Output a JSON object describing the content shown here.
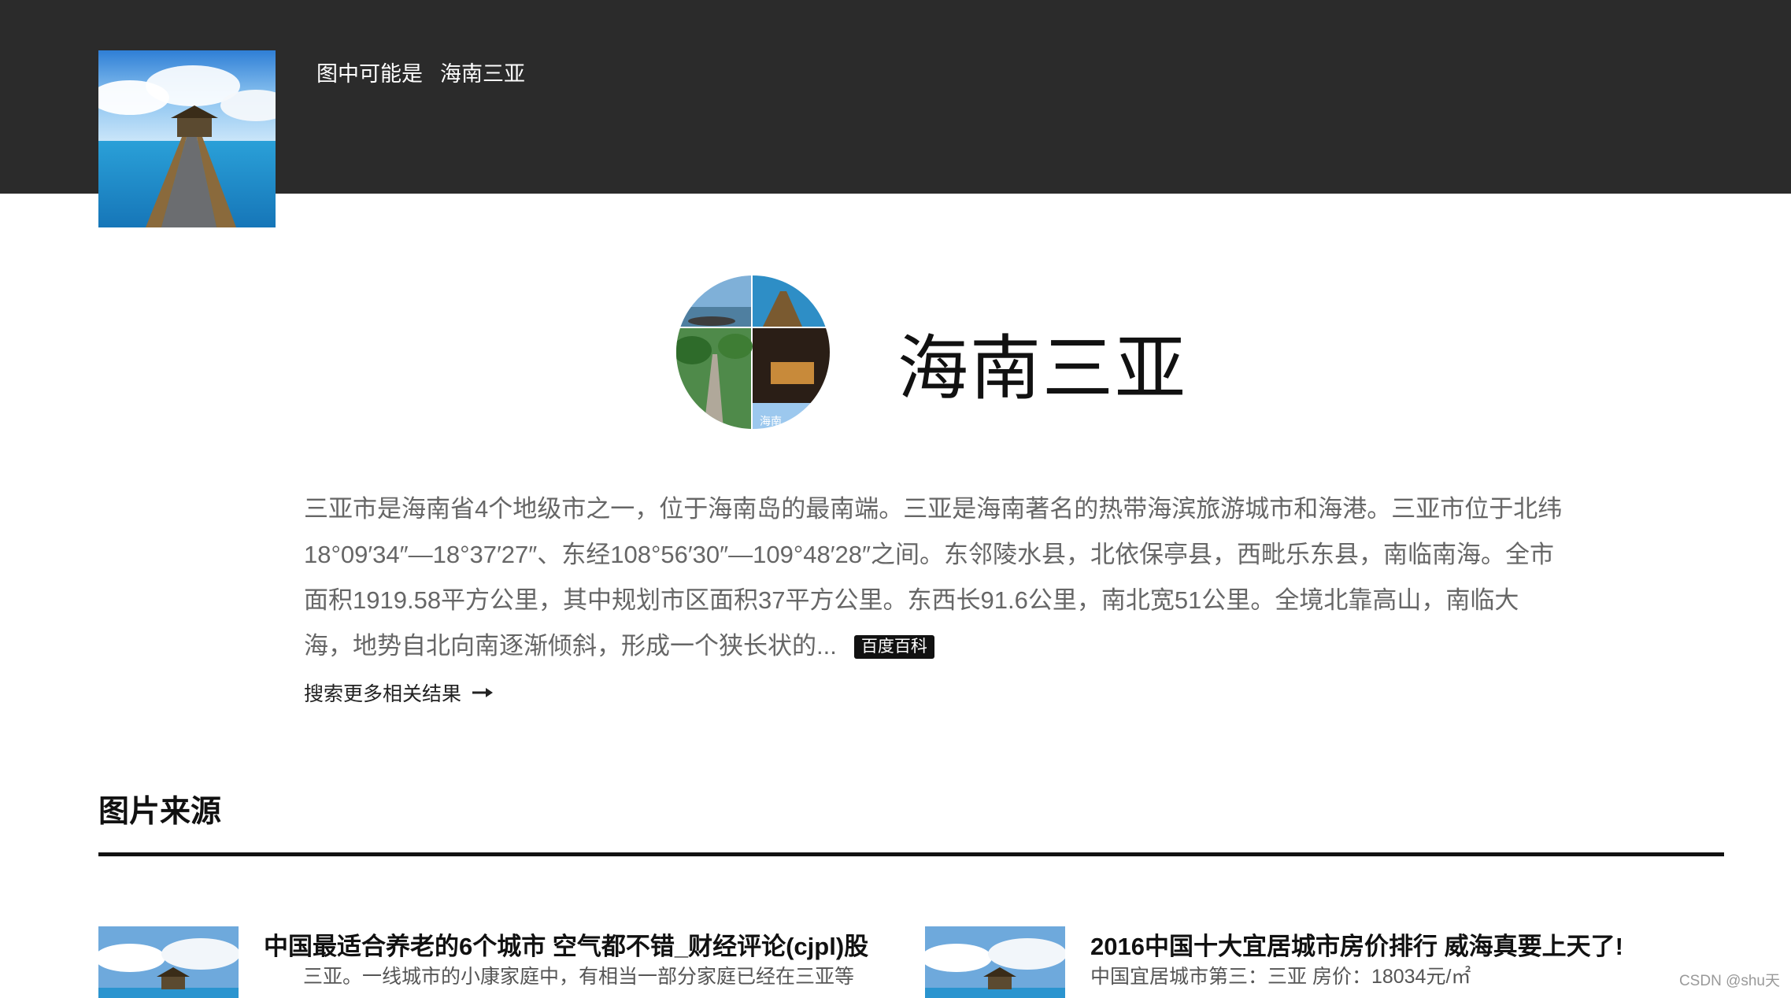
{
  "header": {
    "guess_label": "图中可能是",
    "guess_value": "海南三亚"
  },
  "hero": {
    "title": "海南三亚",
    "collage_caption": "海南"
  },
  "description": {
    "lines": [
      "三亚市是海南省4个地级市之一，位于海南岛的最南端。三亚是海南著名的热带海滨旅游城市和海港。三亚市位于北纬",
      "18°09′34″—18°37′27″、东经108°56′30″—109°48′28″之间。东邻陵水县，北依保亭县，西毗乐东县，南临南海。全市",
      "面积1919.58平方公里，其中规划市区面积37平方公里。东西长91.6公里，南北宽51公里。全境北靠高山，南临大",
      "海，地势自北向南逐渐倾斜，形成一个狭长状的..."
    ],
    "source_badge": "百度百科",
    "more_link": "搜索更多相关结果"
  },
  "sources": {
    "heading": "图片来源",
    "cards": [
      {
        "title": "中国最适合养老的6个城市 空气都不错_财经评论(cjpl)股",
        "snippet": "三亚。一线城市的小康家庭中，有相当一部分家庭已经在三亚等"
      },
      {
        "title": "2016中国十大宜居城市房价排行 威海真要上天了!",
        "snippet": "中国宜居城市第三：三亚 房价：18034元/㎡"
      }
    ]
  },
  "watermark": "CSDN @shu天",
  "colors": {
    "topbar": "#2b2b2b",
    "text_primary": "#111111",
    "text_secondary": "#666666",
    "badge_bg": "#111111"
  }
}
